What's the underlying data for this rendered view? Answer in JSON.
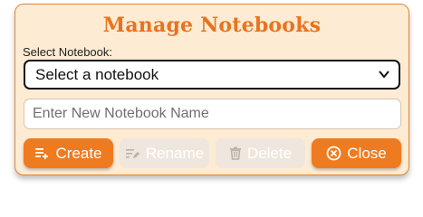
{
  "dialog": {
    "title": "Manage Notebooks",
    "select_label": "Select Notebook:",
    "select_value": "Select a notebook",
    "input_placeholder": "Enter New Notebook Name",
    "buttons": {
      "create": "Create",
      "rename": "Rename",
      "delete": "Delete",
      "close": "Close"
    },
    "icons": {
      "create": "playlist-add-icon",
      "rename": "edit-lines-icon",
      "delete": "trash-icon",
      "close": "close-circle-icon",
      "select": "chevron-down-icon"
    }
  },
  "colors": {
    "accent": "#ef7b20",
    "title": "#e8731f",
    "panel_bg": "#fdebd3",
    "panel_border": "#d98a3c",
    "disabled_bg": "#efe7dd"
  }
}
